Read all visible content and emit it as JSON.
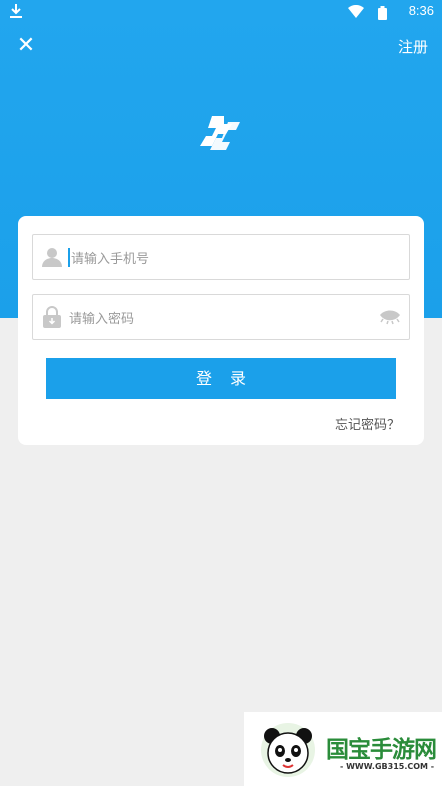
{
  "status_bar": {
    "time": "8:36"
  },
  "header": {
    "register_label": "注册",
    "close_label": "✕"
  },
  "login": {
    "phone_placeholder": "请输入手机号",
    "password_placeholder": "请输入密码",
    "login_label": "登录",
    "forgot_label": "忘记密码？"
  },
  "watermark": {
    "brand": "国宝手游网",
    "url": "- WWW.GB315.COM -"
  },
  "colors": {
    "primary": "#1ba0ea",
    "background": "#efefef",
    "card": "#ffffff"
  },
  "icons": [
    "download-icon",
    "wifi-icon",
    "battery-icon",
    "close-icon",
    "app-logo",
    "user-icon",
    "lock-icon",
    "eye-hidden-icon",
    "panda-icon"
  ]
}
